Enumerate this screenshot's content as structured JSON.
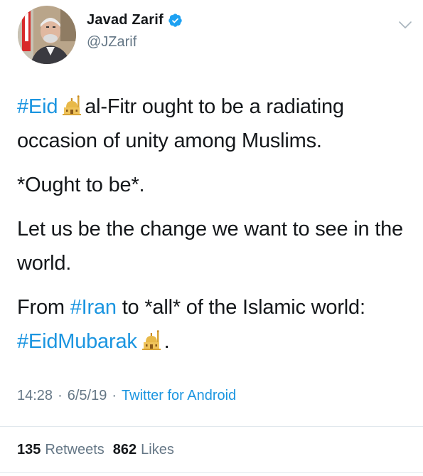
{
  "user": {
    "display_name": "Javad Zarif",
    "handle": "@JZarif",
    "verified": true,
    "avatar_icon": "profile-photo"
  },
  "tweet": {
    "p1_hashtag": "#Eid",
    "p1_text": "al-Fitr ought to be a radiating occasion of unity among Muslims.",
    "p2_text": "*Ought to be*.",
    "p3_text": "Let us be the change we want to see in the world.",
    "p4_prefix": "From",
    "p4_hashtag": "#Iran",
    "p4_mid": "to *all* of the Islamic world:",
    "p4_hashtag2": "#EidMubarak",
    "p4_suffix": ".",
    "emoji_icon": "mosque-icon"
  },
  "meta": {
    "time": "14:28",
    "date": "6/5/19",
    "separator": "·",
    "source": "Twitter for Android"
  },
  "stats": {
    "retweets_count": "135",
    "retweets_label": "Retweets",
    "likes_count": "862",
    "likes_label": "Likes"
  },
  "colors": {
    "link": "#1b95e0",
    "secondary_text": "#657786",
    "primary_text": "#14171a",
    "divider": "#e1e8ed"
  }
}
